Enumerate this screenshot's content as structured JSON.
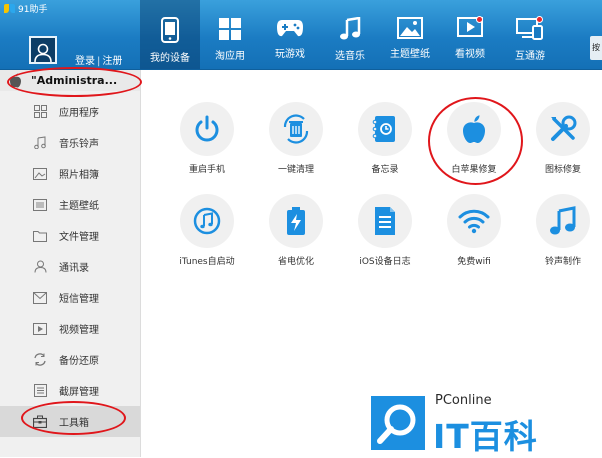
{
  "app": {
    "title": "91助手"
  },
  "auth": {
    "login": "登录",
    "separator": "|",
    "register": "注册"
  },
  "nav": {
    "items": [
      {
        "label": "我的设备",
        "icon": "phone-icon",
        "active": true
      },
      {
        "label": "淘应用",
        "icon": "apps-grid-icon"
      },
      {
        "label": "玩游戏",
        "icon": "gamepad-icon"
      },
      {
        "label": "选音乐",
        "icon": "music-note-icon"
      },
      {
        "label": "主题壁纸",
        "icon": "wallpaper-icon"
      },
      {
        "label": "看视频",
        "icon": "video-icon",
        "badge": true
      },
      {
        "label": "互通游",
        "icon": "screens-icon",
        "badge": true
      }
    ],
    "edge_label": "按"
  },
  "sidebar": {
    "device_name": "\"Administra...",
    "items": [
      {
        "label": "应用程序",
        "icon": "apps-icon"
      },
      {
        "label": "音乐铃声",
        "icon": "music-icon"
      },
      {
        "label": "照片相簿",
        "icon": "photo-icon"
      },
      {
        "label": "主题壁纸",
        "icon": "theme-icon"
      },
      {
        "label": "文件管理",
        "icon": "folder-icon"
      },
      {
        "label": "通讯录",
        "icon": "contacts-icon"
      },
      {
        "label": "短信管理",
        "icon": "sms-icon"
      },
      {
        "label": "视频管理",
        "icon": "video-manage-icon"
      },
      {
        "label": "备份还原",
        "icon": "backup-icon"
      },
      {
        "label": "截屏管理",
        "icon": "screenshot-icon"
      },
      {
        "label": "工具箱",
        "icon": "toolbox-icon",
        "active": true
      }
    ]
  },
  "tools": [
    {
      "label": "重启手机",
      "icon": "power-icon"
    },
    {
      "label": "一键清理",
      "icon": "trash-clean-icon"
    },
    {
      "label": "备忘录",
      "icon": "notebook-icon"
    },
    {
      "label": "白苹果修复",
      "icon": "apple-icon"
    },
    {
      "label": "图标修复",
      "icon": "tools-icon"
    },
    {
      "label": "iTunes自启动",
      "icon": "itunes-icon"
    },
    {
      "label": "省电优化",
      "icon": "battery-icon"
    },
    {
      "label": "iOS设备日志",
      "icon": "log-icon"
    },
    {
      "label": "免费wifi",
      "icon": "wifi-icon"
    },
    {
      "label": "铃声制作",
      "icon": "ringtone-icon"
    }
  ],
  "watermark": {
    "brand": "PConline",
    "text": "IT百科"
  },
  "colors": {
    "accent": "#1c8fe0",
    "topbar": "#1b7cc3",
    "annotation": "#e0161b"
  }
}
